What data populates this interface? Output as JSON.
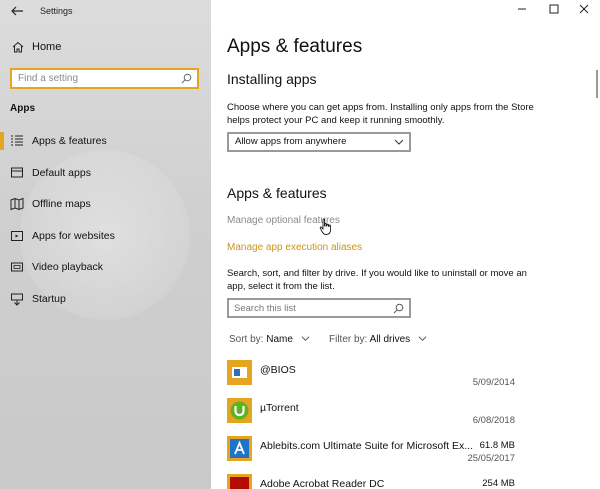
{
  "window": {
    "app_title": "Settings",
    "controls": {
      "minimize": "—",
      "maximize": "☐",
      "close": "✕"
    }
  },
  "sidebar": {
    "home_label": "Home",
    "search_placeholder": "Find a setting",
    "section_label": "Apps",
    "items": [
      {
        "label": "Apps & features",
        "icon": "list-icon",
        "active": true
      },
      {
        "label": "Default apps",
        "icon": "default-apps-icon"
      },
      {
        "label": "Offline maps",
        "icon": "map-icon"
      },
      {
        "label": "Apps for websites",
        "icon": "website-icon"
      },
      {
        "label": "Video playback",
        "icon": "video-icon"
      },
      {
        "label": "Startup",
        "icon": "startup-icon"
      }
    ]
  },
  "main": {
    "title": "Apps & features",
    "installing": {
      "heading": "Installing apps",
      "description": "Choose where you can get apps from. Installing only apps from the Store helps protect your PC and keep it running smoothly.",
      "dropdown_value": "Allow apps from anywhere"
    },
    "features": {
      "heading": "Apps & features",
      "link_optional": "Manage optional features",
      "link_aliases": "Manage app execution aliases",
      "description": "Search, sort, and filter by drive. If you would like to uninstall or move an app, select it from the list.",
      "search_placeholder": "Search this list",
      "sort_label": "Sort by:",
      "sort_value": "Name",
      "filter_label": "Filter by:",
      "filter_value": "All drives"
    },
    "apps": [
      {
        "name": "@BIOS",
        "size": "",
        "date": "5/09/2014"
      },
      {
        "name": "µTorrent",
        "size": "",
        "date": "6/08/2018"
      },
      {
        "name": "Ablebits.com Ultimate Suite for Microsoft Ex...",
        "size": "61.8 MB",
        "date": "25/05/2017"
      },
      {
        "name": "Adobe Acrobat Reader DC",
        "size": "254 MB",
        "date": ""
      }
    ]
  },
  "colors": {
    "accent": "#e6a520",
    "link": "#c9961a",
    "disabled_link": "#8a8a8a"
  }
}
